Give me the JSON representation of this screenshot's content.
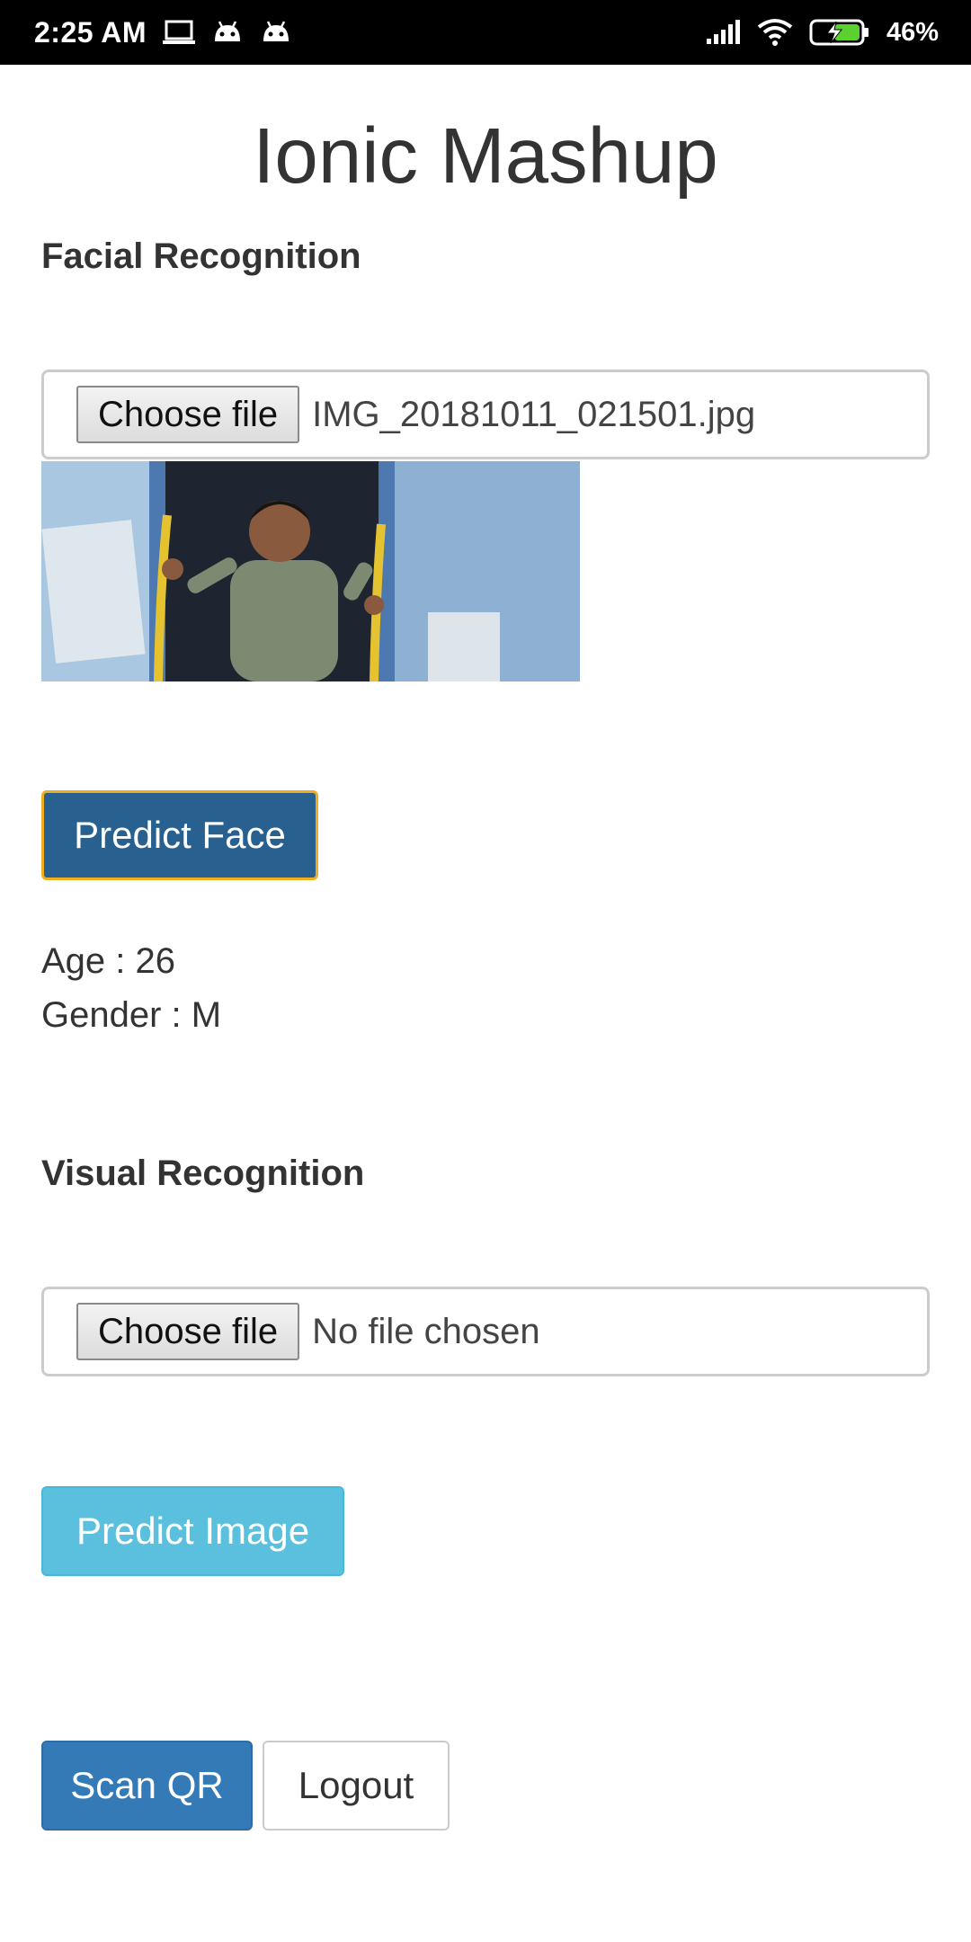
{
  "status_bar": {
    "time": "2:25 AM",
    "icons_left": [
      "laptop-icon",
      "android-icon",
      "android-icon"
    ],
    "icons_right": [
      "signal-icon",
      "wifi-icon",
      "battery-charging-icon"
    ],
    "battery": "46%"
  },
  "title": "Ionic Mashup",
  "facial": {
    "heading": "Facial Recognition",
    "choose_label": "Choose file",
    "file_name": "IMG_20181011_021501.jpg",
    "predict_label": "Predict Face",
    "age_text": "Age : 26",
    "gender_text": "Gender : M"
  },
  "visual": {
    "heading": "Visual Recognition",
    "choose_label": "Choose file",
    "file_name": "No file chosen",
    "predict_label": "Predict Image"
  },
  "actions": {
    "scan_label": "Scan QR",
    "logout_label": "Logout"
  },
  "colors": {
    "primary": "#337ab7",
    "primary_dark": "#286090",
    "info": "#5bc0de",
    "focus_outline": "#f0ad1e"
  }
}
